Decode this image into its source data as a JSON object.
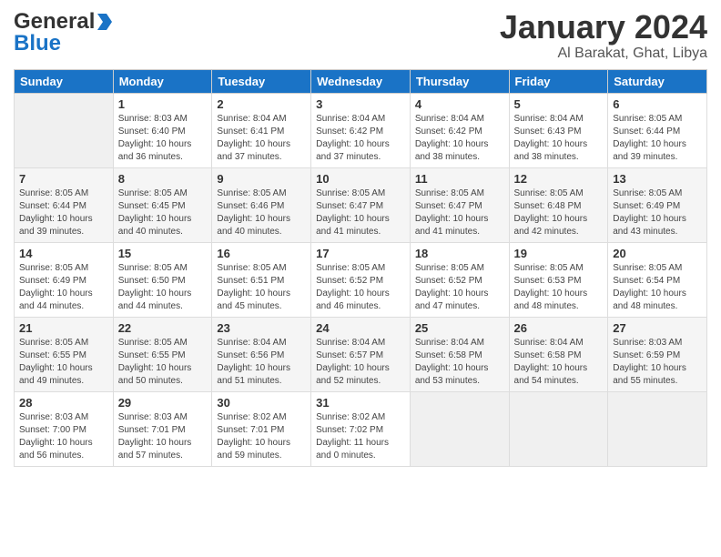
{
  "header": {
    "logo_general": "General",
    "logo_blue": "Blue",
    "title": "January 2024",
    "location": "Al Barakat, Ghat, Libya"
  },
  "days_of_week": [
    "Sunday",
    "Monday",
    "Tuesday",
    "Wednesday",
    "Thursday",
    "Friday",
    "Saturday"
  ],
  "weeks": [
    [
      {
        "day": "",
        "empty": true
      },
      {
        "day": "1",
        "sunrise": "Sunrise: 8:03 AM",
        "sunset": "Sunset: 6:40 PM",
        "daylight": "Daylight: 10 hours and 36 minutes."
      },
      {
        "day": "2",
        "sunrise": "Sunrise: 8:04 AM",
        "sunset": "Sunset: 6:41 PM",
        "daylight": "Daylight: 10 hours and 37 minutes."
      },
      {
        "day": "3",
        "sunrise": "Sunrise: 8:04 AM",
        "sunset": "Sunset: 6:42 PM",
        "daylight": "Daylight: 10 hours and 37 minutes."
      },
      {
        "day": "4",
        "sunrise": "Sunrise: 8:04 AM",
        "sunset": "Sunset: 6:42 PM",
        "daylight": "Daylight: 10 hours and 38 minutes."
      },
      {
        "day": "5",
        "sunrise": "Sunrise: 8:04 AM",
        "sunset": "Sunset: 6:43 PM",
        "daylight": "Daylight: 10 hours and 38 minutes."
      },
      {
        "day": "6",
        "sunrise": "Sunrise: 8:05 AM",
        "sunset": "Sunset: 6:44 PM",
        "daylight": "Daylight: 10 hours and 39 minutes."
      }
    ],
    [
      {
        "day": "7",
        "sunrise": "Sunrise: 8:05 AM",
        "sunset": "Sunset: 6:44 PM",
        "daylight": "Daylight: 10 hours and 39 minutes."
      },
      {
        "day": "8",
        "sunrise": "Sunrise: 8:05 AM",
        "sunset": "Sunset: 6:45 PM",
        "daylight": "Daylight: 10 hours and 40 minutes."
      },
      {
        "day": "9",
        "sunrise": "Sunrise: 8:05 AM",
        "sunset": "Sunset: 6:46 PM",
        "daylight": "Daylight: 10 hours and 40 minutes."
      },
      {
        "day": "10",
        "sunrise": "Sunrise: 8:05 AM",
        "sunset": "Sunset: 6:47 PM",
        "daylight": "Daylight: 10 hours and 41 minutes."
      },
      {
        "day": "11",
        "sunrise": "Sunrise: 8:05 AM",
        "sunset": "Sunset: 6:47 PM",
        "daylight": "Daylight: 10 hours and 41 minutes."
      },
      {
        "day": "12",
        "sunrise": "Sunrise: 8:05 AM",
        "sunset": "Sunset: 6:48 PM",
        "daylight": "Daylight: 10 hours and 42 minutes."
      },
      {
        "day": "13",
        "sunrise": "Sunrise: 8:05 AM",
        "sunset": "Sunset: 6:49 PM",
        "daylight": "Daylight: 10 hours and 43 minutes."
      }
    ],
    [
      {
        "day": "14",
        "sunrise": "Sunrise: 8:05 AM",
        "sunset": "Sunset: 6:49 PM",
        "daylight": "Daylight: 10 hours and 44 minutes."
      },
      {
        "day": "15",
        "sunrise": "Sunrise: 8:05 AM",
        "sunset": "Sunset: 6:50 PM",
        "daylight": "Daylight: 10 hours and 44 minutes."
      },
      {
        "day": "16",
        "sunrise": "Sunrise: 8:05 AM",
        "sunset": "Sunset: 6:51 PM",
        "daylight": "Daylight: 10 hours and 45 minutes."
      },
      {
        "day": "17",
        "sunrise": "Sunrise: 8:05 AM",
        "sunset": "Sunset: 6:52 PM",
        "daylight": "Daylight: 10 hours and 46 minutes."
      },
      {
        "day": "18",
        "sunrise": "Sunrise: 8:05 AM",
        "sunset": "Sunset: 6:52 PM",
        "daylight": "Daylight: 10 hours and 47 minutes."
      },
      {
        "day": "19",
        "sunrise": "Sunrise: 8:05 AM",
        "sunset": "Sunset: 6:53 PM",
        "daylight": "Daylight: 10 hours and 48 minutes."
      },
      {
        "day": "20",
        "sunrise": "Sunrise: 8:05 AM",
        "sunset": "Sunset: 6:54 PM",
        "daylight": "Daylight: 10 hours and 48 minutes."
      }
    ],
    [
      {
        "day": "21",
        "sunrise": "Sunrise: 8:05 AM",
        "sunset": "Sunset: 6:55 PM",
        "daylight": "Daylight: 10 hours and 49 minutes."
      },
      {
        "day": "22",
        "sunrise": "Sunrise: 8:05 AM",
        "sunset": "Sunset: 6:55 PM",
        "daylight": "Daylight: 10 hours and 50 minutes."
      },
      {
        "day": "23",
        "sunrise": "Sunrise: 8:04 AM",
        "sunset": "Sunset: 6:56 PM",
        "daylight": "Daylight: 10 hours and 51 minutes."
      },
      {
        "day": "24",
        "sunrise": "Sunrise: 8:04 AM",
        "sunset": "Sunset: 6:57 PM",
        "daylight": "Daylight: 10 hours and 52 minutes."
      },
      {
        "day": "25",
        "sunrise": "Sunrise: 8:04 AM",
        "sunset": "Sunset: 6:58 PM",
        "daylight": "Daylight: 10 hours and 53 minutes."
      },
      {
        "day": "26",
        "sunrise": "Sunrise: 8:04 AM",
        "sunset": "Sunset: 6:58 PM",
        "daylight": "Daylight: 10 hours and 54 minutes."
      },
      {
        "day": "27",
        "sunrise": "Sunrise: 8:03 AM",
        "sunset": "Sunset: 6:59 PM",
        "daylight": "Daylight: 10 hours and 55 minutes."
      }
    ],
    [
      {
        "day": "28",
        "sunrise": "Sunrise: 8:03 AM",
        "sunset": "Sunset: 7:00 PM",
        "daylight": "Daylight: 10 hours and 56 minutes."
      },
      {
        "day": "29",
        "sunrise": "Sunrise: 8:03 AM",
        "sunset": "Sunset: 7:01 PM",
        "daylight": "Daylight: 10 hours and 57 minutes."
      },
      {
        "day": "30",
        "sunrise": "Sunrise: 8:02 AM",
        "sunset": "Sunset: 7:01 PM",
        "daylight": "Daylight: 10 hours and 59 minutes."
      },
      {
        "day": "31",
        "sunrise": "Sunrise: 8:02 AM",
        "sunset": "Sunset: 7:02 PM",
        "daylight": "Daylight: 11 hours and 0 minutes."
      },
      {
        "day": "",
        "empty": true
      },
      {
        "day": "",
        "empty": true
      },
      {
        "day": "",
        "empty": true
      }
    ]
  ]
}
